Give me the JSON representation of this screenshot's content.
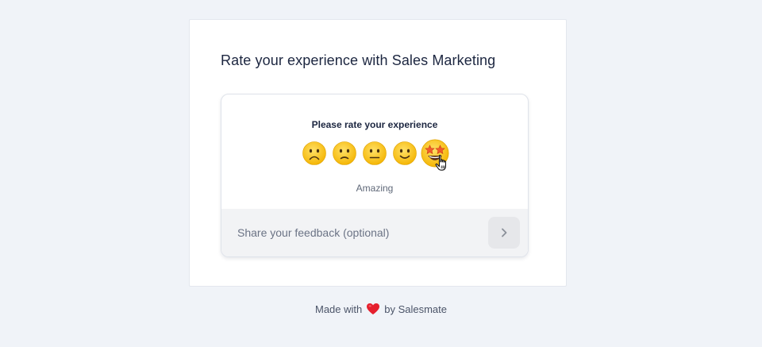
{
  "form": {
    "title": "Rate your experience with Sales Marketing",
    "prompt": "Please rate your experience",
    "selected_rating_label": "Amazing",
    "options": [
      {
        "icon": "frowning-face-icon"
      },
      {
        "icon": "slightly-frowning-face-icon"
      },
      {
        "icon": "neutral-face-icon"
      },
      {
        "icon": "slightly-smiling-face-icon"
      },
      {
        "icon": "star-struck-face-icon",
        "selected": true
      }
    ],
    "feedback": {
      "placeholder": "Share your feedback (optional)",
      "value": "",
      "send_icon": "chevron-right-icon"
    }
  },
  "footer": {
    "prefix": "Made with",
    "heart_icon": "heart-icon",
    "suffix": "by Salesmate"
  },
  "colors": {
    "page_background": "#f0f3f8",
    "heading_text": "#1c2640",
    "emoji_yellow": "#fcc21b",
    "heart_red": "#e5202e"
  }
}
